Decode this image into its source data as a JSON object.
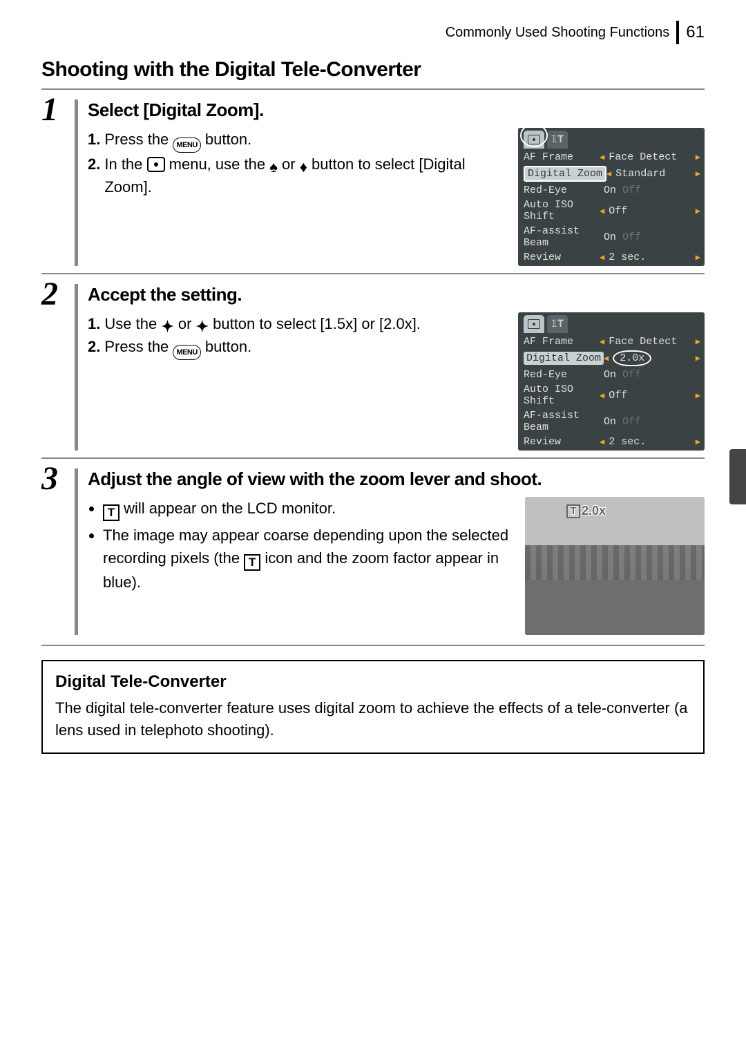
{
  "header": {
    "breadcrumb": "Commonly Used Shooting Functions",
    "page_number": "61"
  },
  "section_title": "Shooting with the Digital Tele-Converter",
  "steps": [
    {
      "num": "1",
      "title": "Select [Digital Zoom].",
      "sub1_a": "Press the ",
      "sub1_b": " button.",
      "sub2_a": "In the ",
      "sub2_b": " menu, use the ",
      "sub2_c": " or ",
      "sub2_d": " button to select [Digital Zoom].",
      "menu": {
        "rows": [
          {
            "label": "AF Frame",
            "value": "Face Detect"
          },
          {
            "label": "Digital Zoom",
            "value": "Standard",
            "highlight": true
          },
          {
            "label": "Red-Eye",
            "value_on": "On",
            "value_off": "Off"
          },
          {
            "label": "Auto ISO Shift",
            "value": "Off"
          },
          {
            "label": "AF-assist Beam",
            "value_on": "On",
            "value_off": "Off"
          },
          {
            "label": "Review",
            "value": "2 sec."
          }
        ]
      }
    },
    {
      "num": "2",
      "title": "Accept the setting.",
      "sub1_a": "Use the ",
      "sub1_b": " or ",
      "sub1_c": " button to select [1.5x] or [2.0x].",
      "sub2_a": "Press the ",
      "sub2_b": " button.",
      "menu": {
        "rows": [
          {
            "label": "AF Frame",
            "value": "Face Detect"
          },
          {
            "label": "Digital Zoom",
            "value": "2.0x",
            "highlight": true,
            "oval": true
          },
          {
            "label": "Red-Eye",
            "value_on": "On",
            "value_off": "Off"
          },
          {
            "label": "Auto ISO Shift",
            "value": "Off"
          },
          {
            "label": "AF-assist Beam",
            "value_on": "On",
            "value_off": "Off"
          },
          {
            "label": "Review",
            "value": "2 sec."
          }
        ]
      }
    },
    {
      "num": "3",
      "title": "Adjust the angle of view with the zoom lever and shoot.",
      "bullet1_a": "",
      "bullet1_b": " will appear on the LCD monitor.",
      "bullet2_a": "The image may appear coarse depending upon the selected recording pixels (the ",
      "bullet2_b": " icon and the zoom factor appear in blue).",
      "lcd_badge": "2.0x"
    }
  ],
  "info": {
    "title": "Digital Tele-Converter",
    "body": "The digital tele-converter feature uses digital zoom to achieve the effects of a tele-converter (a lens used in telephoto shooting)."
  },
  "labels": {
    "sub1": "1.",
    "sub2": "2."
  }
}
